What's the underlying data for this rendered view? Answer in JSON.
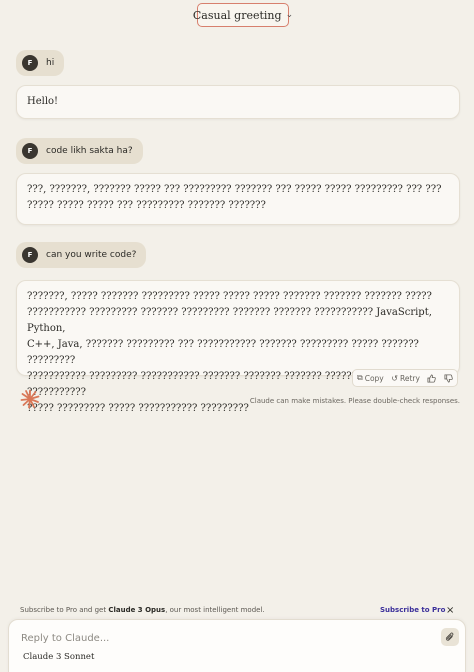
{
  "header": {
    "title": "Casual greeting",
    "chevron_icon": "chevron-down-icon"
  },
  "messages": [
    {
      "role": "user",
      "avatar": "F",
      "text": "hi"
    },
    {
      "role": "assistant",
      "lines": [
        "Hello!"
      ]
    },
    {
      "role": "user",
      "avatar": "F",
      "text": "code likh sakta ha?"
    },
    {
      "role": "assistant",
      "lines": [
        "???, ???????, ??????? ????? ??? ????????? ??????? ??? ?????  ????? ????????? ???  ???",
        "????? ????? ????? ??? ????????? ??????? ???????"
      ]
    },
    {
      "role": "user",
      "avatar": "F",
      "text": "can you write code?"
    },
    {
      "role": "assistant",
      "lines": [
        "???????, ????? ??????? ????????? ????? ?????  ????? ??????? ??????? ??????? ?????",
        "??????????? ????????? ??????? ????????? ??????? ??????? ??????????? JavaScript, Python,",
        "C++, Java, ??????? ????????? ??? ??????????? ??????? ????????? ????? ???????  ?????????",
        "??????????? ????????? ??????????? ??????? ??????? ??????? ??????????????? ??? ???????????",
        "????? ????????? ????? ??????????? ?????????"
      ]
    }
  ],
  "actions": {
    "copy": "Copy",
    "retry": "Retry"
  },
  "disclaimer": "Claude can make mistakes. Please double-check responses.",
  "promo": {
    "text_prefix": "Subscribe to Pro and get ",
    "model_highlight": "Claude 3 Opus",
    "text_suffix": ", our most intelligent model.",
    "link": "Subscribe to Pro",
    "close": "×"
  },
  "composer": {
    "placeholder": "Reply to Claude...",
    "model_label": "Claude 3 Sonnet",
    "attach_icon": "paperclip-icon"
  },
  "colors": {
    "background": "#f3f0e9",
    "accent": "#d77f6d",
    "link": "#3b2f9a",
    "avatar": "#3a3630",
    "user_bubble": "#e6dfd0",
    "claude_logo": "#d97757"
  }
}
